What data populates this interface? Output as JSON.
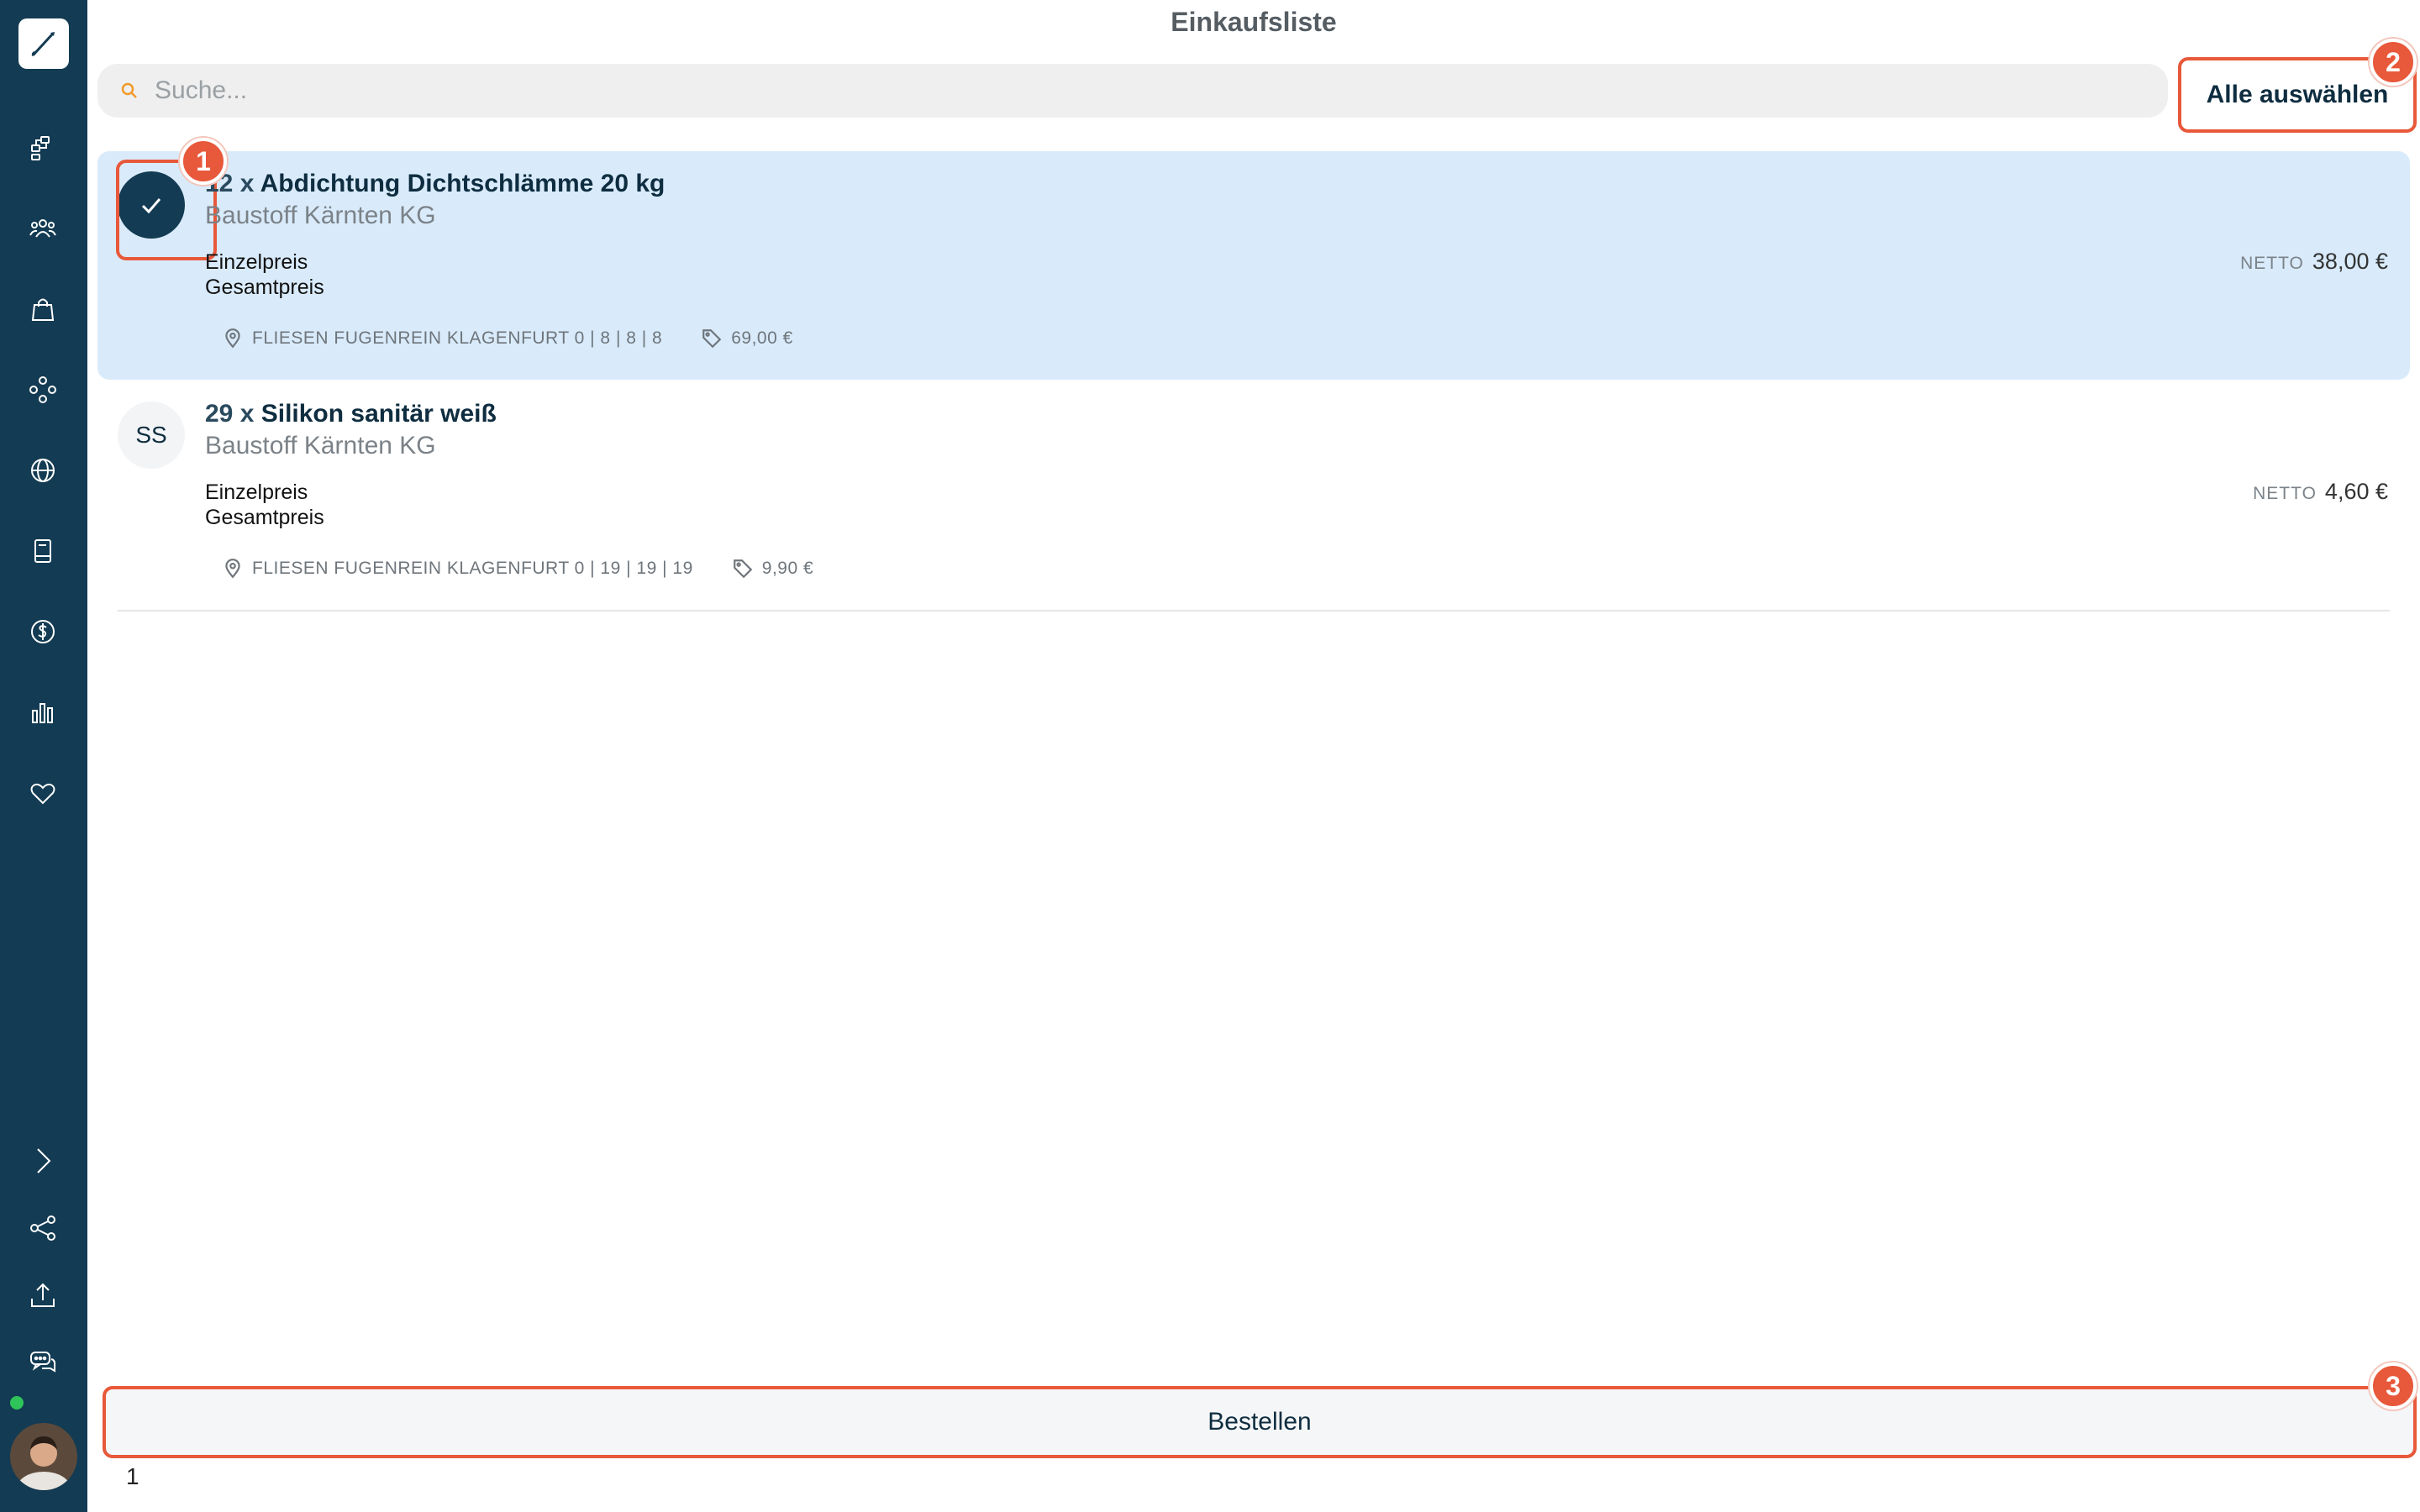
{
  "header": {
    "title": "Einkaufsliste"
  },
  "search": {
    "placeholder": "Suche..."
  },
  "actions": {
    "select_all": "Alle auswählen",
    "order": "Bestellen"
  },
  "callouts": [
    "1",
    "2",
    "3"
  ],
  "items": [
    {
      "quantity": "12 x",
      "name": "Abdichtung Dichtschlämme 20 kg",
      "supplier": "Baustoff Kärnten KG",
      "unit_price_label": "Einzelpreis",
      "total_price_label": "Gesamtpreis",
      "netto_label": "NETTO",
      "netto_price": "38,00 €",
      "location": "FLIESEN FUGENREIN KLAGENFURT 0 | 8 | 8 | 8",
      "list_price": "69,00 €",
      "selected": true
    },
    {
      "quantity": "29 x",
      "name": "Silikon sanitär weiß",
      "initials": "SS",
      "supplier": "Baustoff Kärnten KG",
      "unit_price_label": "Einzelpreis",
      "total_price_label": "Gesamtpreis",
      "netto_label": "NETTO",
      "netto_price": "4,60 €",
      "location": "FLIESEN FUGENREIN KLAGENFURT 0 | 19 | 19 | 19",
      "list_price": "9,90 €",
      "selected": false
    }
  ],
  "pagination": {
    "current": "1"
  },
  "sidebar": {
    "icons": [
      "brush-logo-icon",
      "workflow-icon",
      "team-icon",
      "shopping-bag-icon",
      "network-icon",
      "globe-icon",
      "book-icon",
      "dollar-icon",
      "bar-chart-icon",
      "heart-icon",
      "chevron-right-icon",
      "share-icon",
      "upload-icon",
      "chat-icon"
    ]
  },
  "colors": {
    "sidebar": "#133b53",
    "accent": "#e8583a",
    "selected_row": "#d9ebfb"
  }
}
